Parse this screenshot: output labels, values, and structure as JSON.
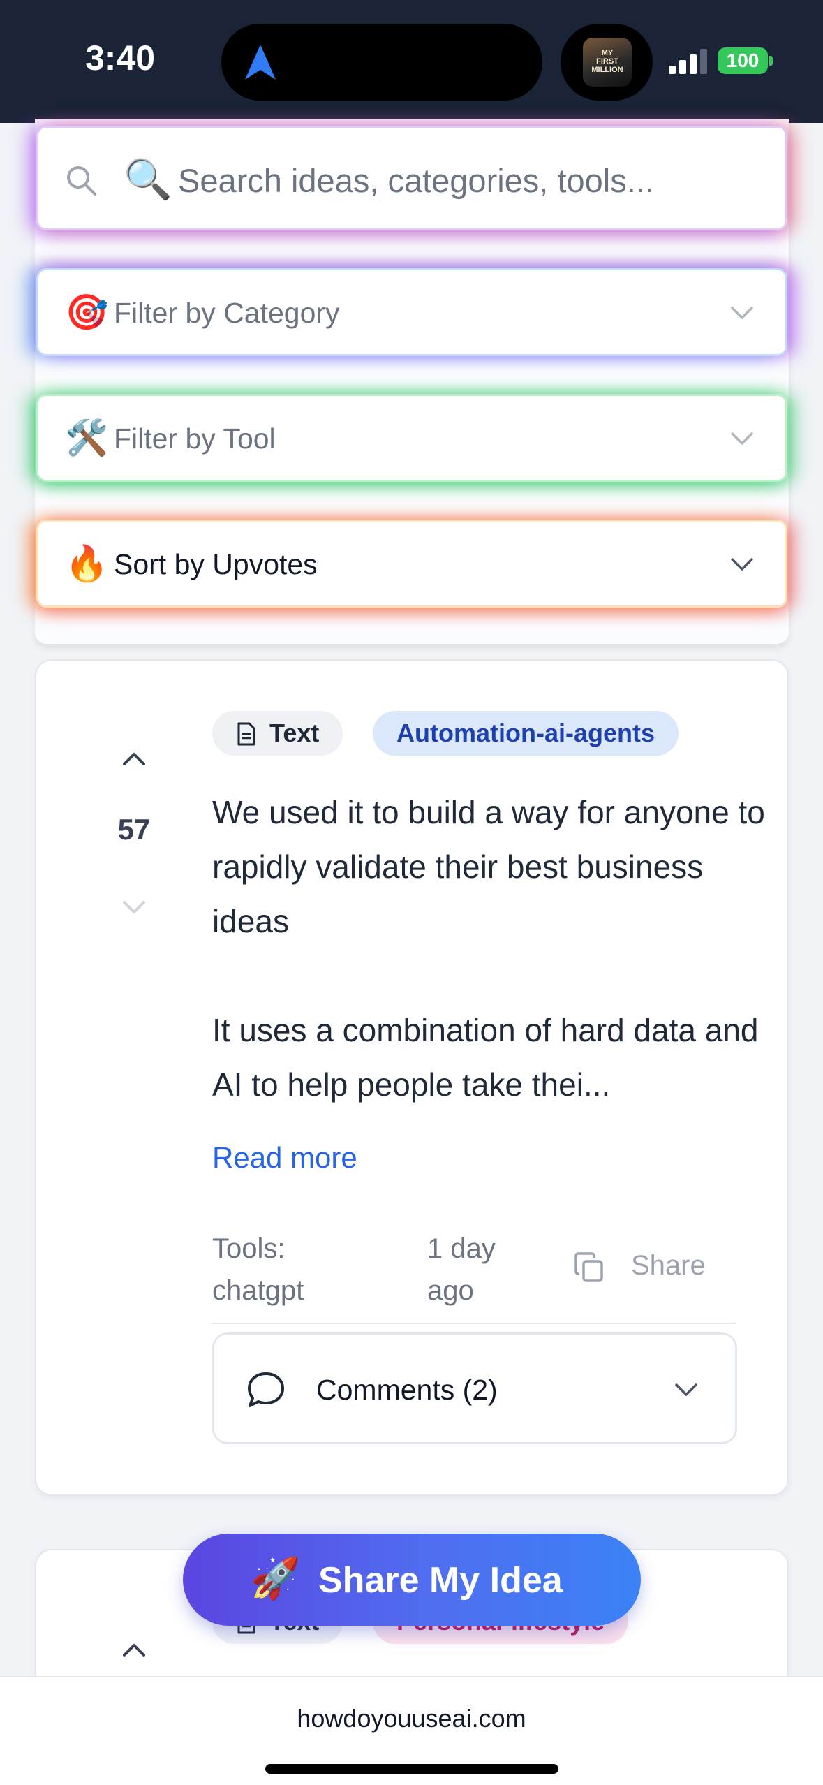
{
  "status_bar": {
    "time": "3:40",
    "battery": "100",
    "now_playing_art": [
      "MY",
      "FIRST",
      "MILLION"
    ]
  },
  "filters": {
    "search": {
      "emoji": "🔍",
      "placeholder": "Search ideas, categories, tools..."
    },
    "category": {
      "emoji": "🎯",
      "label": "Filter by Category"
    },
    "tool": {
      "emoji": "🛠️",
      "label": "Filter by Tool"
    },
    "sort": {
      "emoji": "🔥",
      "label": "Sort by Upvotes"
    }
  },
  "ideas": [
    {
      "votes": "57",
      "type": "Text",
      "category": "Automation-ai-agents",
      "text_line1": "We used it to build a way for anyone to rapidly validate their best business ideas",
      "text_line2": "It uses a combination of hard data and AI to help people take thei...",
      "read_more": "Read more",
      "tools_label": "Tools:",
      "tools_value": "chatgpt",
      "time_ago": "1 day ago",
      "share_label": "Share",
      "comments_label": "Comments (2)"
    },
    {
      "type": "Text",
      "category": "Personal-lifestyle"
    }
  ],
  "cta": {
    "emoji": "🚀",
    "label": "Share My Idea"
  },
  "browser": {
    "url": "howdoyouuseai.com"
  },
  "colors": {
    "accent_link": "#2563eb",
    "status_bar_bg": "#1b2437",
    "cta_gradient_start": "#5b45e0",
    "cta_gradient_end": "#3b82f6",
    "battery_green": "#34c759"
  }
}
